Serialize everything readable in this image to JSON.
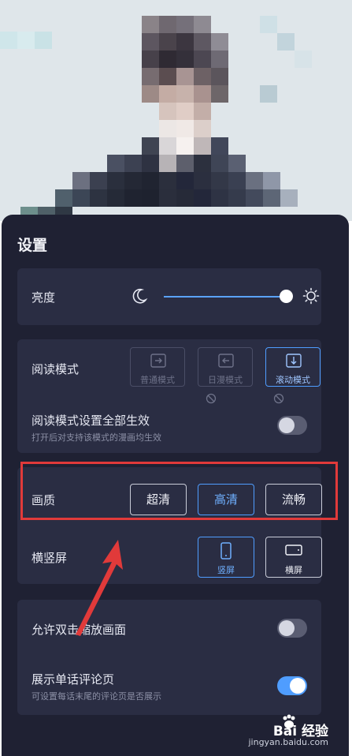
{
  "panel": {
    "title": "设置"
  },
  "brightness": {
    "label": "亮度",
    "level_fraction": 0.97
  },
  "reading_mode": {
    "label": "阅读模式",
    "options": [
      "普通模式",
      "日漫模式",
      "滚动模式"
    ],
    "selected": "滚动模式"
  },
  "apply_all": {
    "label": "阅读模式设置全部生效",
    "description": "打开后对支持该模式的漫画均生效",
    "enabled": false
  },
  "quality": {
    "label": "画质",
    "options": [
      "超清",
      "高清",
      "流畅"
    ],
    "selected": "高清"
  },
  "orientation": {
    "label": "横竖屏",
    "options": [
      "竖屏",
      "横屏"
    ],
    "selected": "竖屏"
  },
  "double_tap_zoom": {
    "label": "允许双击缩放画面",
    "enabled": false
  },
  "comment_page": {
    "label": "展示单话评论页",
    "description": "可设置每话末尾的评论页是否展示",
    "enabled": true
  },
  "watermark": {
    "brand": "Bai 经验",
    "url": "jingyan.baidu.com"
  },
  "colors": {
    "accent": "#4f9dff",
    "panel": "#1f2133",
    "card": "#2a2d43",
    "highlight": "#e13a3a"
  }
}
